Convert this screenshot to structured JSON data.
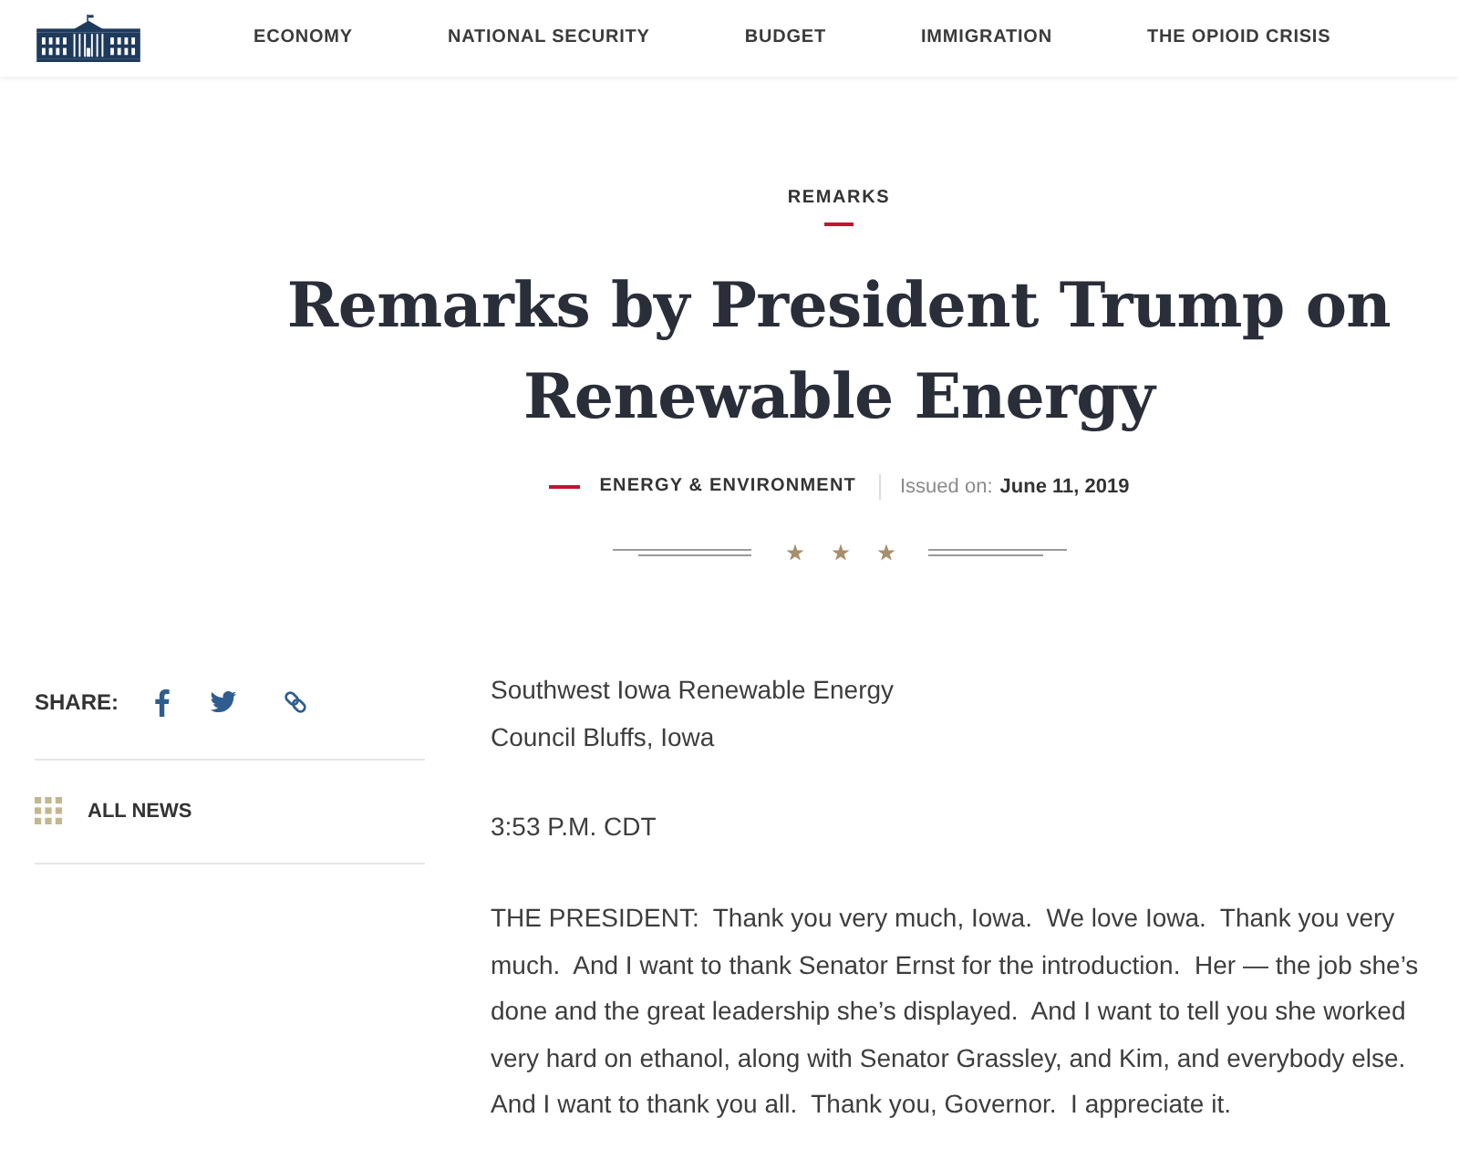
{
  "header": {
    "nav": [
      "ECONOMY",
      "NATIONAL SECURITY",
      "BUDGET",
      "IMMIGRATION",
      "THE OPIOID CRISIS"
    ]
  },
  "article_header": {
    "category": "REMARKS",
    "title": "Remarks by President Trump on Renewable Energy",
    "topic": "ENERGY & ENVIRONMENT",
    "issued_label": "Issued on:",
    "issued_date": "June 11, 2019"
  },
  "sidebar": {
    "share_label": "SHARE:",
    "all_news": "ALL NEWS"
  },
  "body": {
    "location": [
      "Southwest Iowa Renewable Energy",
      "Council Bluffs, Iowa"
    ],
    "time": "3:53 P.M. CDT",
    "paragraphs": [
      "THE PRESIDENT:  Thank you very much, Iowa.  We love Iowa.  Thank you very much.  And I want to thank Senator Ernst for the introduction.  Her — the job she’s done and the great leadership she’s displayed.  And I want to tell you she worked very hard on ethanol, along with Senator Grassley, and Kim, and everybody else.  And I want to thank you all.  Thank you, Governor.  I appreciate it."
    ]
  }
}
